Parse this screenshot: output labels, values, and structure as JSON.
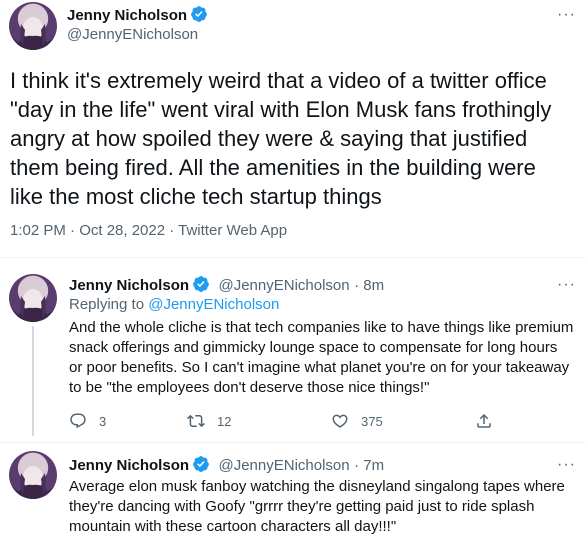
{
  "colors": {
    "accent": "#1d9bf0",
    "muted": "#536471",
    "text": "#0f1419"
  },
  "main_tweet": {
    "author_name": "Jenny Nicholson",
    "author_handle": "@JennyENicholson",
    "more_label": "···",
    "text": "I think it's extremely weird that a video of a twitter office \"day in the life\" went viral with Elon Musk fans frothingly angry at how spoiled they were & saying that justified them being fired. All the amenities in the building were like the most cliche tech startup things",
    "timestamp": "1:02 PM · Oct 28, 2022 · Twitter Web App"
  },
  "replies": [
    {
      "author_name": "Jenny Nicholson",
      "author_handle": "@JennyENicholson",
      "time": "· 8m",
      "replying_prefix": "Replying to ",
      "replying_handle": "@JennyENicholson",
      "text": "And the whole cliche is that tech companies like to have things like premium snack offerings and gimmicky lounge space to compensate for long hours or poor benefits. So I can't imagine what planet you're on for your takeaway to be \"the employees don't deserve those nice things!\"",
      "reply_count": "3",
      "retweet_count": "12",
      "like_count": "375",
      "more_label": "···"
    },
    {
      "author_name": "Jenny Nicholson",
      "author_handle": "@JennyENicholson",
      "time": "· 7m",
      "text": "Average elon musk fanboy watching the disneyland singalong tapes where they're dancing with Goofy \"grrrr they're getting paid just to ride splash mountain with these cartoon characters all day!!!\"",
      "more_label": "···"
    }
  ],
  "icons": [
    "verified-badge-icon",
    "more-icon",
    "reply-icon",
    "retweet-icon",
    "like-icon",
    "share-icon"
  ]
}
